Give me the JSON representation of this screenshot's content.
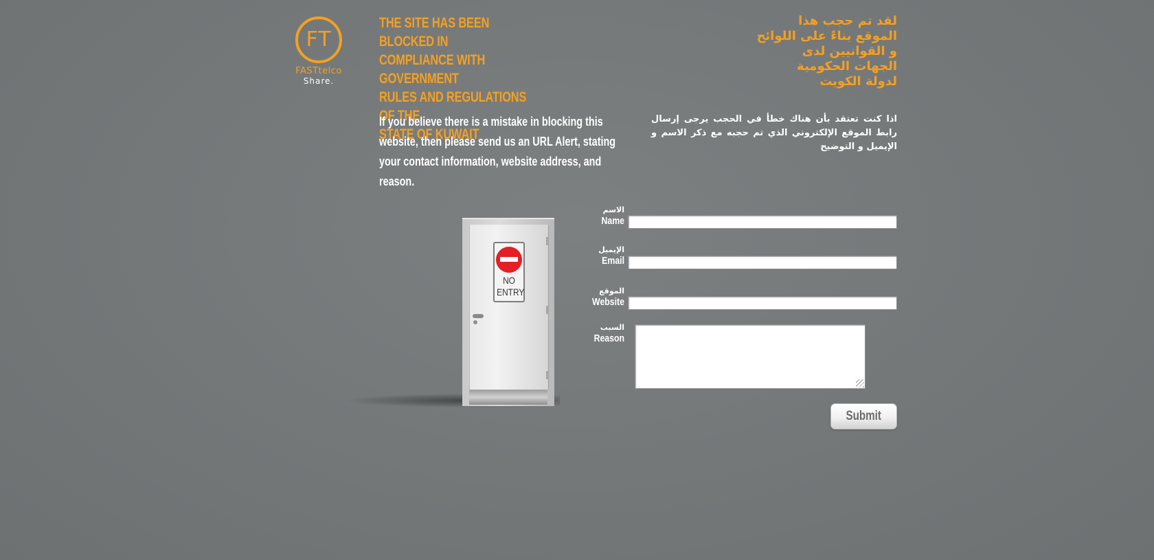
{
  "logo": {
    "mark": "FT",
    "brand": "FASTtelco",
    "tagline": "Share."
  },
  "headline": {
    "english": "The site has been blocked in\ncompliance with government\nrules and regulations of the\nstate of Kuwait",
    "arabic": "لقد تم حجب هذا\nالموقع بناءً على اللوائح\nو القوانيين لدى\nالجهات الحكومية\nلدولة الكويت"
  },
  "info": {
    "english": "If you believe there is a mistake in blocking this website, then please send us an URL Alert, stating your contact information, website address, and reason.",
    "arabic": "اذا كنت تعتقد بأن هناك خطأ في الحجب يرجى إرسال رابط الموقع الإلكتروني الذي تم حجبه مع ذكر الاسم و الإيميل و التوضيح"
  },
  "illustration": {
    "sign_text": "NO\nENTRY"
  },
  "form": {
    "name": {
      "label_ar": "الاسم",
      "label_en": "Name",
      "value": ""
    },
    "email": {
      "label_ar": "الإيميل",
      "label_en": "Email",
      "value": ""
    },
    "website": {
      "label_ar": "الموقع",
      "label_en": "Website",
      "value": ""
    },
    "reason": {
      "label_ar": "السبب",
      "label_en": "Reason",
      "value": ""
    },
    "submit_label": "Submit"
  },
  "colors": {
    "accent": "#f5a021",
    "sign_red": "#e41f26",
    "text_light": "#ffffff"
  }
}
